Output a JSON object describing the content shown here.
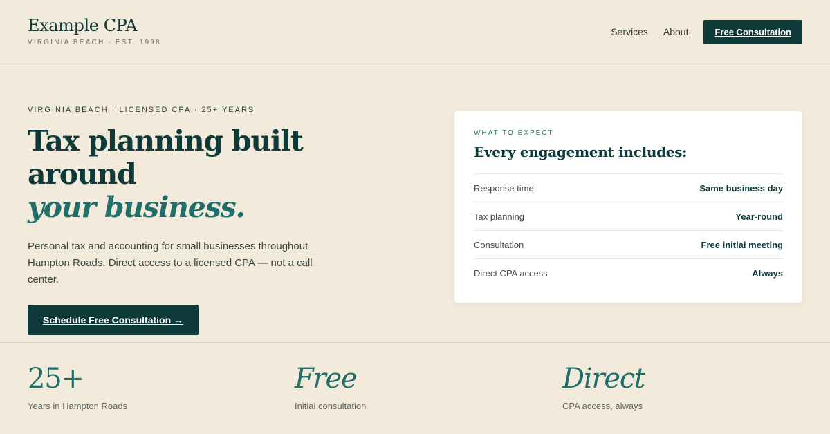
{
  "brand": {
    "name": "Example CPA",
    "subtitle": "VIRGINIA BEACH · EST. 1998"
  },
  "nav": {
    "links": [
      "Services",
      "About"
    ],
    "cta": "Free Consultation"
  },
  "hero": {
    "eyebrow": "VIRGINIA BEACH · LICENSED CPA · 25+ YEARS",
    "headline_line1": "Tax planning built around",
    "headline_line2": "your business.",
    "lead": "Personal tax and accounting for small businesses throughout Hampton Roads. Direct access to a licensed CPA — not a call center.",
    "cta": "Schedule Free Consultation →"
  },
  "card": {
    "eyebrow": "WHAT TO EXPECT",
    "title": "Every engagement includes:",
    "rows": [
      {
        "key": "Response time",
        "value": "Same business day"
      },
      {
        "key": "Tax planning",
        "value": "Year-round"
      },
      {
        "key": "Consultation",
        "value": "Free initial meeting"
      },
      {
        "key": "Direct CPA access",
        "value": "Always"
      }
    ]
  },
  "stats": [
    {
      "big": "25+",
      "label": "Years in Hampton Roads"
    },
    {
      "big": "Free",
      "label": "Initial consultation"
    },
    {
      "big": "Direct",
      "label": "CPA access, always"
    }
  ],
  "colors": {
    "background": "#f2eadb",
    "primary": "#0f3a3a",
    "accent": "#1f6e6a",
    "card": "#ffffff"
  }
}
